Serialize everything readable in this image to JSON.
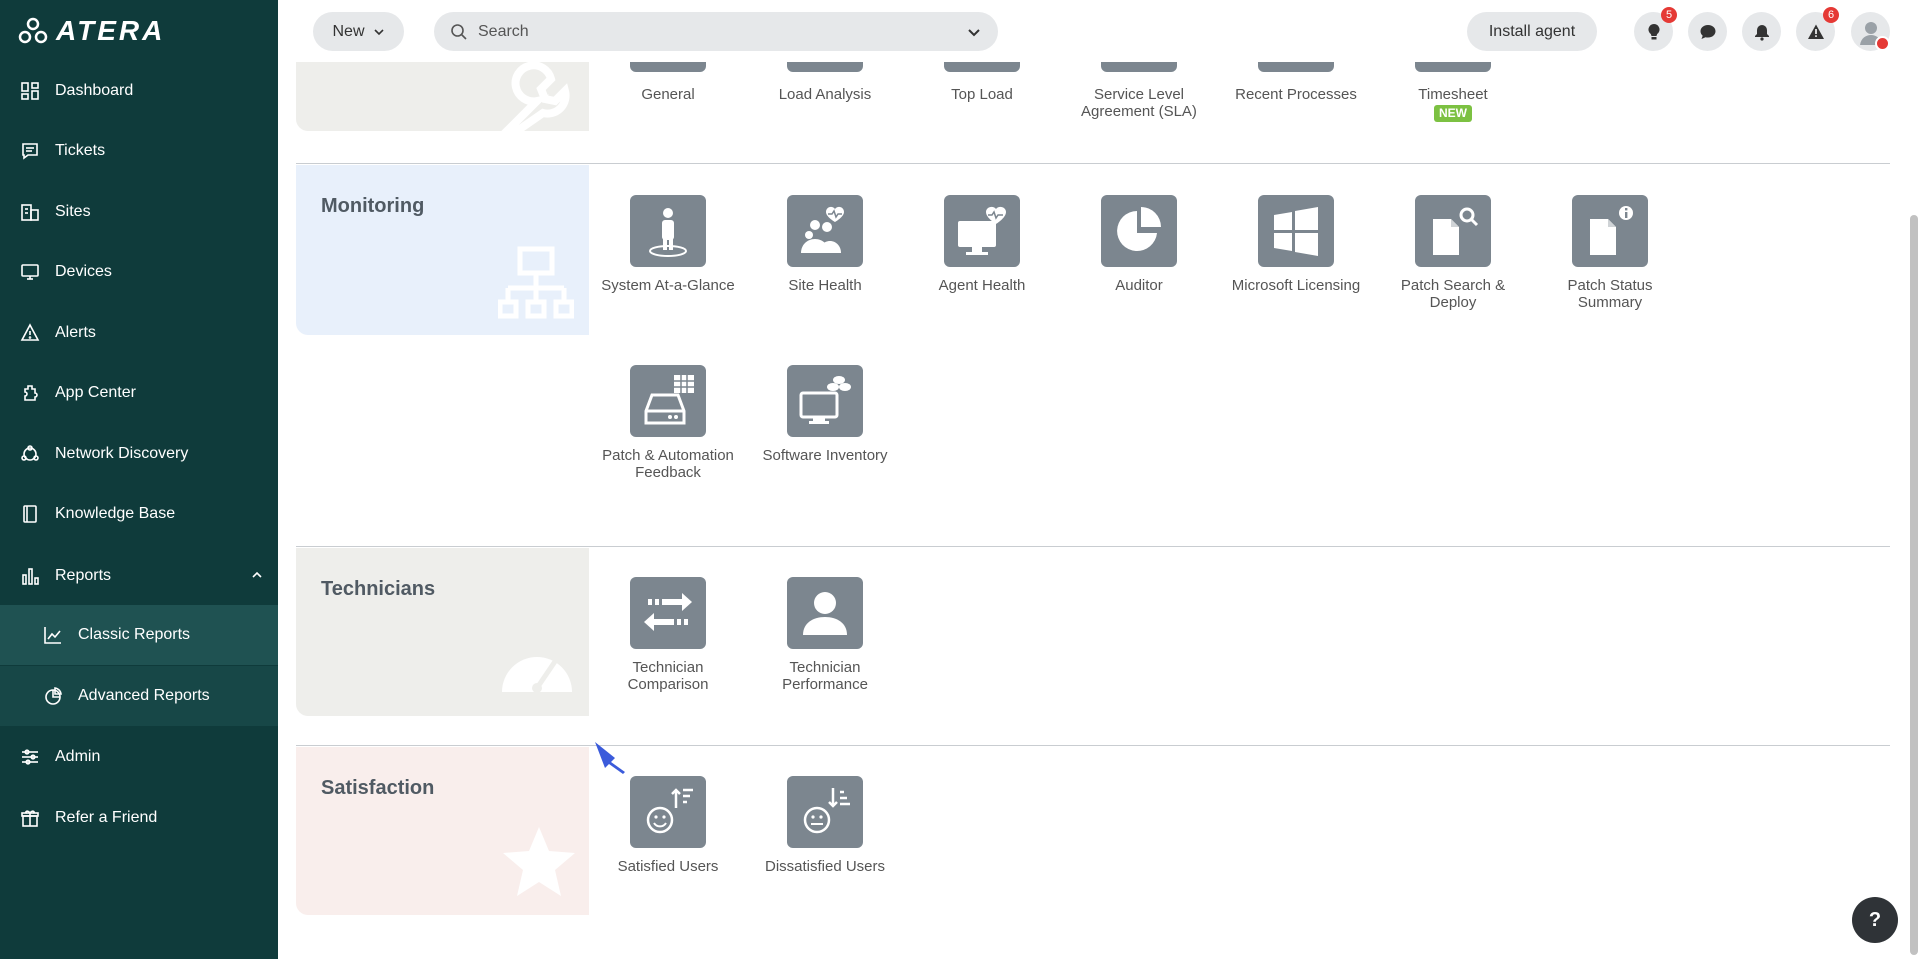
{
  "brand": {
    "name": "ATERA"
  },
  "sidebar": {
    "items": [
      {
        "label": "Dashboard",
        "icon": "dashboard-icon"
      },
      {
        "label": "Tickets",
        "icon": "tickets-icon"
      },
      {
        "label": "Sites",
        "icon": "sites-icon"
      },
      {
        "label": "Devices",
        "icon": "devices-icon"
      },
      {
        "label": "Alerts",
        "icon": "alerts-icon"
      },
      {
        "label": "App Center",
        "icon": "app-center-icon"
      },
      {
        "label": "Network Discovery",
        "icon": "network-discovery-icon"
      },
      {
        "label": "Knowledge Base",
        "icon": "knowledge-base-icon"
      },
      {
        "label": "Reports",
        "icon": "reports-icon",
        "expanded": true
      },
      {
        "label": "Classic Reports",
        "icon": "classic-reports-icon",
        "active": true
      },
      {
        "label": "Advanced Reports",
        "icon": "advanced-reports-icon"
      },
      {
        "label": "Admin",
        "icon": "admin-icon"
      },
      {
        "label": "Refer a Friend",
        "icon": "gift-icon"
      }
    ]
  },
  "topbar": {
    "new_label": "New",
    "search_placeholder": "Search",
    "install_label": "Install agent",
    "ideas_badge": "5",
    "alerts_badge": "6"
  },
  "sections": {
    "top": {
      "tiles": [
        {
          "label": "General"
        },
        {
          "label": "Load Analysis"
        },
        {
          "label": "Top Load"
        },
        {
          "label": "Service Level Agreement (SLA)"
        },
        {
          "label": "Recent Processes"
        },
        {
          "label": "Timesheet",
          "tag": "NEW"
        }
      ]
    },
    "monitoring": {
      "title": "Monitoring",
      "tiles": [
        {
          "label": "System At-a-Glance",
          "icon": "person-target-icon"
        },
        {
          "label": "Site Health",
          "icon": "group-heartbeat-icon"
        },
        {
          "label": "Agent Health",
          "icon": "monitor-heartbeat-icon"
        },
        {
          "label": "Auditor",
          "icon": "pie-chart-icon"
        },
        {
          "label": "Microsoft Licensing",
          "icon": "windows-logo-icon"
        },
        {
          "label": "Patch Search & Deploy",
          "icon": "document-search-icon"
        },
        {
          "label": "Patch Status Summary",
          "icon": "document-info-icon"
        },
        {
          "label": "Patch & Automation Feedback",
          "icon": "drive-grid-icon"
        },
        {
          "label": "Software Inventory",
          "icon": "monitor-packages-icon"
        }
      ]
    },
    "technicians": {
      "title": "Technicians",
      "tiles": [
        {
          "label": "Technician Comparison",
          "icon": "arrows-swap-icon"
        },
        {
          "label": "Technician Performance",
          "icon": "person-icon"
        }
      ]
    },
    "satisfaction": {
      "title": "Satisfaction",
      "tiles": [
        {
          "label": "Satisfied Users",
          "icon": "smiley-sort-up-icon"
        },
        {
          "label": "Dissatisfied Users",
          "icon": "neutral-face-sort-down-icon"
        }
      ]
    }
  },
  "help": {
    "label": "?"
  },
  "colors": {
    "sidebar_bg": "#0f3b3b",
    "tile_bg": "#7c868f",
    "monitoring_bg": "#e8f0fb",
    "technicians_bg": "#eeeeeb",
    "satisfaction_bg": "#f9eeec",
    "top_bg": "#eeeeeb",
    "new_tag": "#7cc142",
    "badge": "#e53935"
  }
}
